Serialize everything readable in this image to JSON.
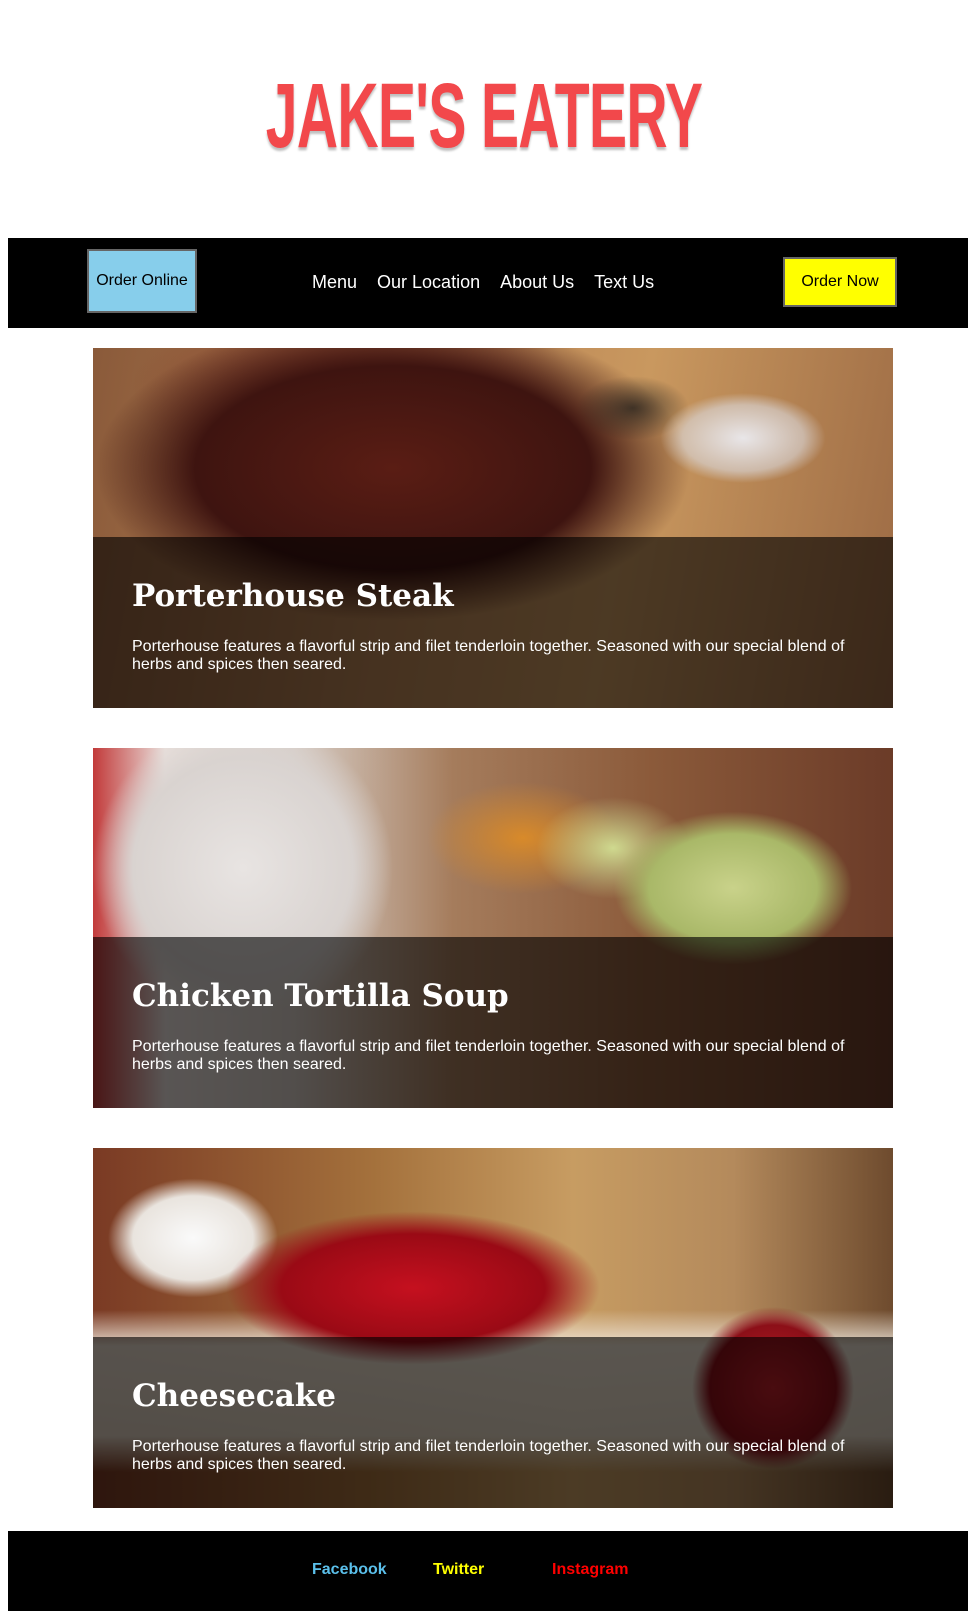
{
  "header": {
    "logo_text": "JAKE'S EATERY"
  },
  "nav": {
    "order_online_label": "Order Online",
    "links": [
      "Menu",
      "Our Location",
      "About Us",
      "Text Us"
    ],
    "order_now_label": "Order Now"
  },
  "cards": [
    {
      "title": "Porterhouse Steak",
      "description": "Porterhouse features a flavorful strip and filet tenderloin together. Seasoned with our special blend of herbs and spices then seared."
    },
    {
      "title": "Chicken Tortilla Soup",
      "description": "Porterhouse features a flavorful strip and filet tenderloin together. Seasoned with our special blend of herbs and spices then seared."
    },
    {
      "title": "Cheesecake",
      "description": "Porterhouse features a flavorful strip and filet tenderloin together. Seasoned with our special blend of herbs and spices then seared."
    }
  ],
  "footer": {
    "links": [
      {
        "label": "Facebook",
        "color": "#5bc0eb"
      },
      {
        "label": "Twitter",
        "color": "#ffff00"
      },
      {
        "label": "Instagram",
        "color": "#ff0000"
      }
    ]
  },
  "colors": {
    "logo": "#f2484b",
    "order_online_bg": "#87ceeb",
    "order_now_bg": "#ffff00",
    "bar_bg": "#000000"
  }
}
